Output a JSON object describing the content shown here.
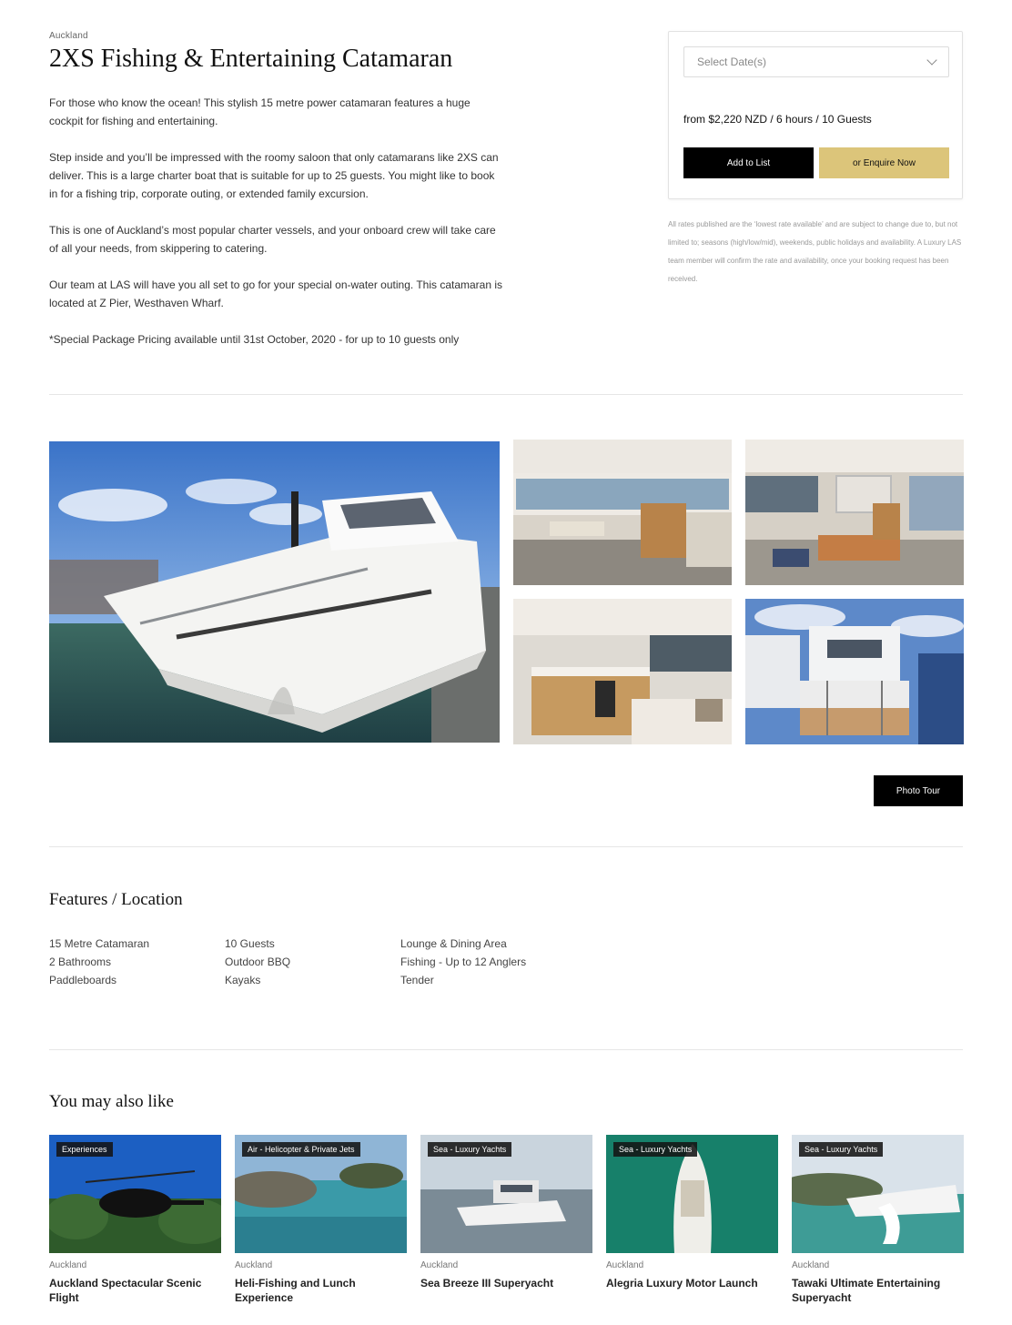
{
  "listing": {
    "location": "Auckland",
    "title": "2XS Fishing & Entertaining Catamaran",
    "description": [
      "For those who know the ocean! This stylish 15 metre power catamaran features a huge cockpit for fishing and entertaining.",
      "Step inside and you’ll be impressed with the roomy saloon that only catamarans like 2XS can deliver. This is a large charter boat that is suitable for up to 25 guests. You might like to book in for a fishing trip, corporate outing, or extended family excursion.",
      "This is one of Auckland’s most popular charter vessels, and your onboard crew will take care of all your needs, from skippering to catering.",
      "Our team at LAS will have you all set to go for your special on-water outing. This catamaran is located at Z Pier, Westhaven Wharf.",
      "*Special Package Pricing available until 31st October, 2020 - for up to 10 guests only"
    ]
  },
  "booking": {
    "date_placeholder": "Select Date(s)",
    "price": "from $2,220 NZD / 6 hours / 10 Guests",
    "add_label": "Add to List",
    "enquire_label": "or Enquire Now",
    "disclaimer": "All rates published are the ‘lowest rate available’ and are subject to change due to, but not limited to; seasons (high/low/mid), weekends, public holidays and availability. A Luxury LAS team member will confirm the rate and availability, once your booking request has been received."
  },
  "gallery": {
    "tour_label": "Photo Tour"
  },
  "features": {
    "title": "Features / Location",
    "columns": [
      [
        "15 Metre Catamaran",
        "2 Bathrooms",
        "Paddleboards"
      ],
      [
        "10 Guests",
        "Outdoor BBQ",
        "Kayaks"
      ],
      [
        "Lounge & Dining Area",
        "Fishing - Up to 12 Anglers",
        "Tender"
      ]
    ]
  },
  "related": {
    "title": "You may also like",
    "cards": [
      {
        "badge": "Experiences",
        "location": "Auckland",
        "title": "Auckland Spectacular Scenic Flight"
      },
      {
        "badge": "Air - Helicopter & Private Jets",
        "location": "Auckland",
        "title": "Heli-Fishing and Lunch Experience"
      },
      {
        "badge": "Sea - Luxury Yachts",
        "location": "Auckland",
        "title": "Sea Breeze III Superyacht"
      },
      {
        "badge": "Sea - Luxury Yachts",
        "location": "Auckland",
        "title": "Alegria Luxury Motor Launch"
      },
      {
        "badge": "Sea - Luxury Yachts",
        "location": "Auckland",
        "title": "Tawaki Ultimate Entertaining Superyacht"
      }
    ]
  },
  "colors": {
    "accent_gold": "#dcc57a",
    "button_black": "#000000"
  }
}
